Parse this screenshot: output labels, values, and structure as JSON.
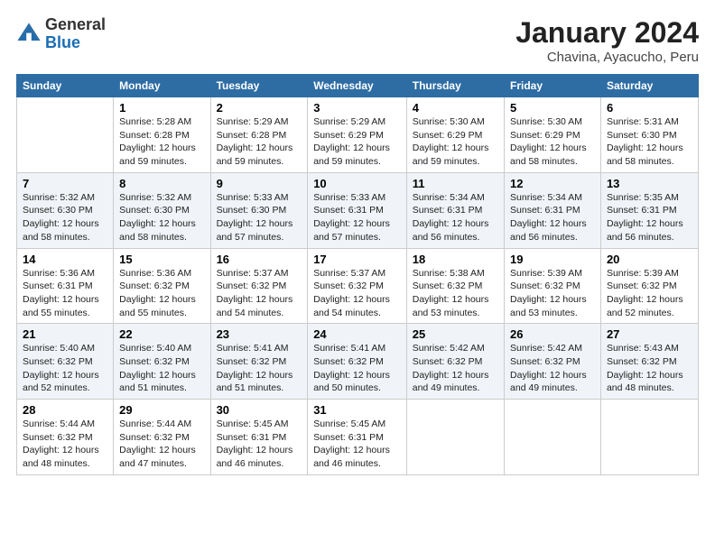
{
  "logo": {
    "general": "General",
    "blue": "Blue"
  },
  "title": "January 2024",
  "subtitle": "Chavina, Ayacucho, Peru",
  "headers": [
    "Sunday",
    "Monday",
    "Tuesday",
    "Wednesday",
    "Thursday",
    "Friday",
    "Saturday"
  ],
  "weeks": [
    [
      {
        "num": "",
        "info": ""
      },
      {
        "num": "1",
        "info": "Sunrise: 5:28 AM\nSunset: 6:28 PM\nDaylight: 12 hours\nand 59 minutes."
      },
      {
        "num": "2",
        "info": "Sunrise: 5:29 AM\nSunset: 6:28 PM\nDaylight: 12 hours\nand 59 minutes."
      },
      {
        "num": "3",
        "info": "Sunrise: 5:29 AM\nSunset: 6:29 PM\nDaylight: 12 hours\nand 59 minutes."
      },
      {
        "num": "4",
        "info": "Sunrise: 5:30 AM\nSunset: 6:29 PM\nDaylight: 12 hours\nand 59 minutes."
      },
      {
        "num": "5",
        "info": "Sunrise: 5:30 AM\nSunset: 6:29 PM\nDaylight: 12 hours\nand 58 minutes."
      },
      {
        "num": "6",
        "info": "Sunrise: 5:31 AM\nSunset: 6:30 PM\nDaylight: 12 hours\nand 58 minutes."
      }
    ],
    [
      {
        "num": "7",
        "info": "Sunrise: 5:32 AM\nSunset: 6:30 PM\nDaylight: 12 hours\nand 58 minutes."
      },
      {
        "num": "8",
        "info": "Sunrise: 5:32 AM\nSunset: 6:30 PM\nDaylight: 12 hours\nand 58 minutes."
      },
      {
        "num": "9",
        "info": "Sunrise: 5:33 AM\nSunset: 6:30 PM\nDaylight: 12 hours\nand 57 minutes."
      },
      {
        "num": "10",
        "info": "Sunrise: 5:33 AM\nSunset: 6:31 PM\nDaylight: 12 hours\nand 57 minutes."
      },
      {
        "num": "11",
        "info": "Sunrise: 5:34 AM\nSunset: 6:31 PM\nDaylight: 12 hours\nand 56 minutes."
      },
      {
        "num": "12",
        "info": "Sunrise: 5:34 AM\nSunset: 6:31 PM\nDaylight: 12 hours\nand 56 minutes."
      },
      {
        "num": "13",
        "info": "Sunrise: 5:35 AM\nSunset: 6:31 PM\nDaylight: 12 hours\nand 56 minutes."
      }
    ],
    [
      {
        "num": "14",
        "info": "Sunrise: 5:36 AM\nSunset: 6:31 PM\nDaylight: 12 hours\nand 55 minutes."
      },
      {
        "num": "15",
        "info": "Sunrise: 5:36 AM\nSunset: 6:32 PM\nDaylight: 12 hours\nand 55 minutes."
      },
      {
        "num": "16",
        "info": "Sunrise: 5:37 AM\nSunset: 6:32 PM\nDaylight: 12 hours\nand 54 minutes."
      },
      {
        "num": "17",
        "info": "Sunrise: 5:37 AM\nSunset: 6:32 PM\nDaylight: 12 hours\nand 54 minutes."
      },
      {
        "num": "18",
        "info": "Sunrise: 5:38 AM\nSunset: 6:32 PM\nDaylight: 12 hours\nand 53 minutes."
      },
      {
        "num": "19",
        "info": "Sunrise: 5:39 AM\nSunset: 6:32 PM\nDaylight: 12 hours\nand 53 minutes."
      },
      {
        "num": "20",
        "info": "Sunrise: 5:39 AM\nSunset: 6:32 PM\nDaylight: 12 hours\nand 52 minutes."
      }
    ],
    [
      {
        "num": "21",
        "info": "Sunrise: 5:40 AM\nSunset: 6:32 PM\nDaylight: 12 hours\nand 52 minutes."
      },
      {
        "num": "22",
        "info": "Sunrise: 5:40 AM\nSunset: 6:32 PM\nDaylight: 12 hours\nand 51 minutes."
      },
      {
        "num": "23",
        "info": "Sunrise: 5:41 AM\nSunset: 6:32 PM\nDaylight: 12 hours\nand 51 minutes."
      },
      {
        "num": "24",
        "info": "Sunrise: 5:41 AM\nSunset: 6:32 PM\nDaylight: 12 hours\nand 50 minutes."
      },
      {
        "num": "25",
        "info": "Sunrise: 5:42 AM\nSunset: 6:32 PM\nDaylight: 12 hours\nand 49 minutes."
      },
      {
        "num": "26",
        "info": "Sunrise: 5:42 AM\nSunset: 6:32 PM\nDaylight: 12 hours\nand 49 minutes."
      },
      {
        "num": "27",
        "info": "Sunrise: 5:43 AM\nSunset: 6:32 PM\nDaylight: 12 hours\nand 48 minutes."
      }
    ],
    [
      {
        "num": "28",
        "info": "Sunrise: 5:44 AM\nSunset: 6:32 PM\nDaylight: 12 hours\nand 48 minutes."
      },
      {
        "num": "29",
        "info": "Sunrise: 5:44 AM\nSunset: 6:32 PM\nDaylight: 12 hours\nand 47 minutes."
      },
      {
        "num": "30",
        "info": "Sunrise: 5:45 AM\nSunset: 6:31 PM\nDaylight: 12 hours\nand 46 minutes."
      },
      {
        "num": "31",
        "info": "Sunrise: 5:45 AM\nSunset: 6:31 PM\nDaylight: 12 hours\nand 46 minutes."
      },
      {
        "num": "",
        "info": ""
      },
      {
        "num": "",
        "info": ""
      },
      {
        "num": "",
        "info": ""
      }
    ]
  ]
}
